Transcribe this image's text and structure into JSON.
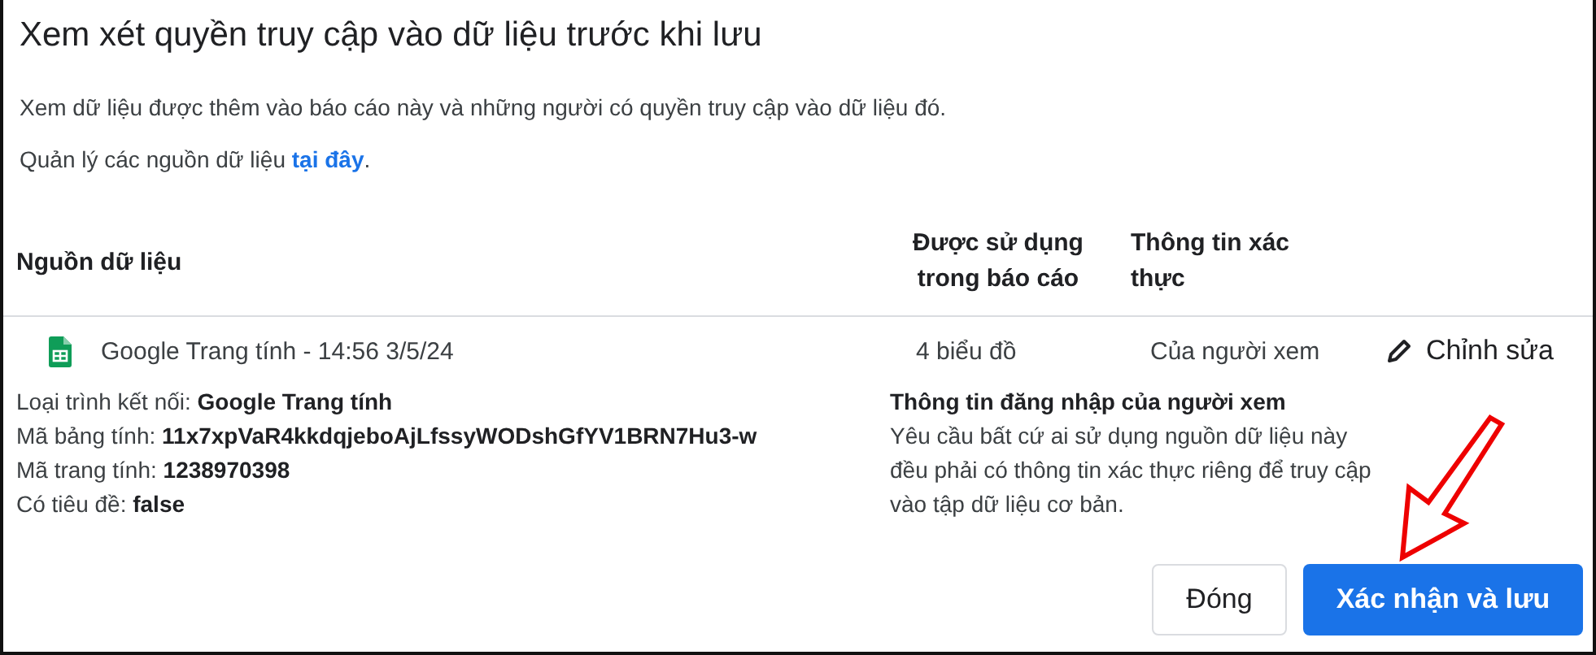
{
  "dialog": {
    "title": "Xem xét quyền truy cập vào dữ liệu trước khi lưu",
    "description": "Xem dữ liệu được thêm vào báo cáo này và những người có quyền truy cập vào dữ liệu đó.",
    "manage_text": "Quản lý các nguồn dữ liệu",
    "manage_link": "tại đây",
    "manage_end": "."
  },
  "table": {
    "columns": [
      "Nguồn dữ liệu",
      "Được sử dụng trong báo cáo",
      "Thông tin xác thực"
    ],
    "rows": [
      {
        "source": "Google Trang tính - 14:56 3/5/24",
        "used_in": "4 biểu đồ",
        "credentials": "Của người xem",
        "edit_label": "Chỉnh sửa",
        "details": [
          {
            "label": "Loại trình kết nối:",
            "value": "Google Trang tính"
          },
          {
            "label": "Mã bảng tính:",
            "value": "11x7xpVaR4kkdqjeboAjLfssyWODshGfYV1BRN7Hu3-w"
          },
          {
            "label": "Mã trang tính:",
            "value": "1238970398"
          },
          {
            "label": "Có tiêu đề:",
            "value": "false"
          }
        ],
        "credential_title": "Thông tin đăng nhập của người xem",
        "credential_lines": [
          "Yêu cầu bất cứ ai sử dụng nguồn dữ liệu này",
          "đều phải có thông tin xác thực riêng để truy cập",
          "vào tập dữ liệu cơ bản."
        ]
      }
    ]
  },
  "buttons": [
    {
      "label": "Đóng",
      "kind": "secondary"
    },
    {
      "label": "Xác nhận và lưu",
      "kind": "primary"
    }
  ]
}
